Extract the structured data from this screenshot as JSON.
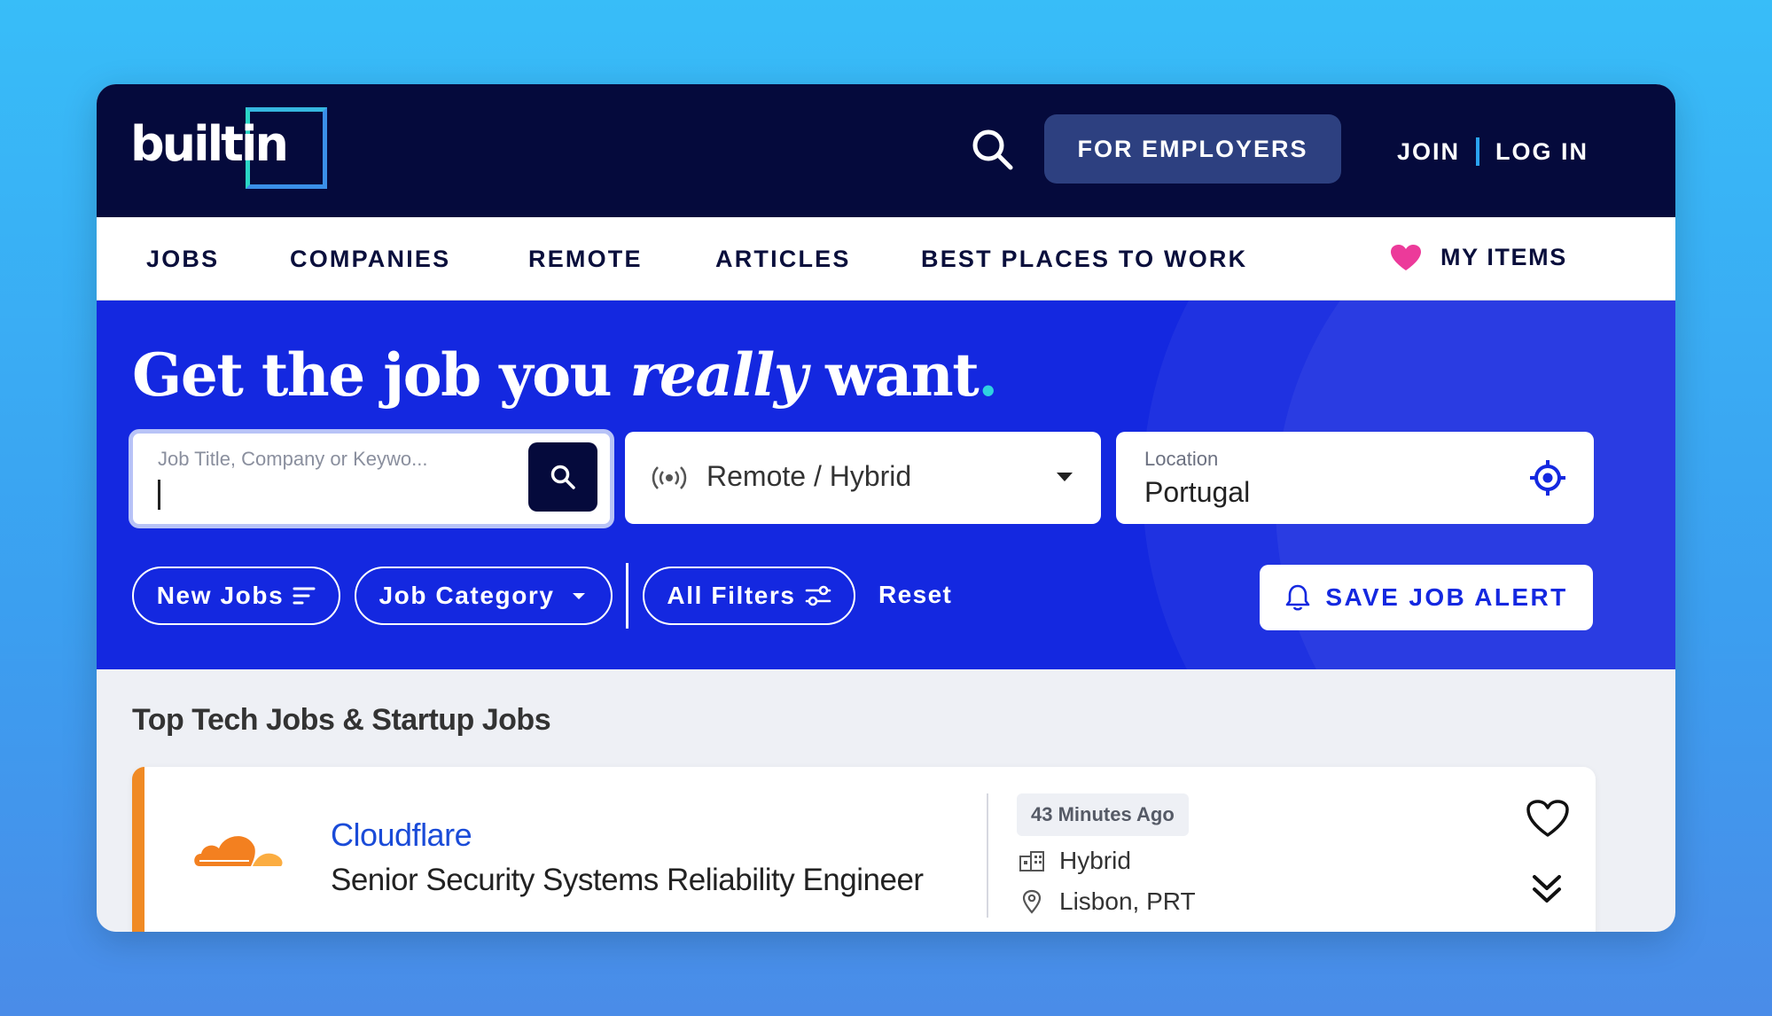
{
  "header": {
    "logo_text": "built",
    "logo_suffix": "in",
    "for_employers": "FOR EMPLOYERS",
    "join": "JOIN",
    "login": "LOG IN"
  },
  "nav": {
    "items": [
      "JOBS",
      "COMPANIES",
      "REMOTE",
      "ARTICLES",
      "BEST PLACES TO WORK"
    ],
    "my_items": "MY ITEMS"
  },
  "hero": {
    "title_part1": "Get the job you ",
    "title_emphasis": "really",
    "title_part2": " want",
    "title_dot": ".",
    "keyword_placeholder": "Job Title, Company or Keywo...",
    "remote_filter": "Remote / Hybrid",
    "location_label": "Location",
    "location_value": "Portugal",
    "filters": {
      "new_jobs": "New Jobs",
      "job_category": "Job Category",
      "all_filters": "All Filters",
      "reset": "Reset"
    },
    "save_alert": "SAVE JOB ALERT"
  },
  "list": {
    "heading": "Top Tech Jobs & Startup Jobs",
    "jobs": [
      {
        "company": "Cloudflare",
        "title": "Senior Security Systems Reliability Engineer",
        "posted": "43 Minutes Ago",
        "work_type": "Hybrid",
        "location": "Lisbon, PRT"
      }
    ]
  },
  "colors": {
    "header_bg": "#050a3c",
    "hero_bg": "#1428e0",
    "accent_pink": "#ec3a9a",
    "company_link": "#1a4bd8",
    "card_accent": "#f08a24"
  }
}
